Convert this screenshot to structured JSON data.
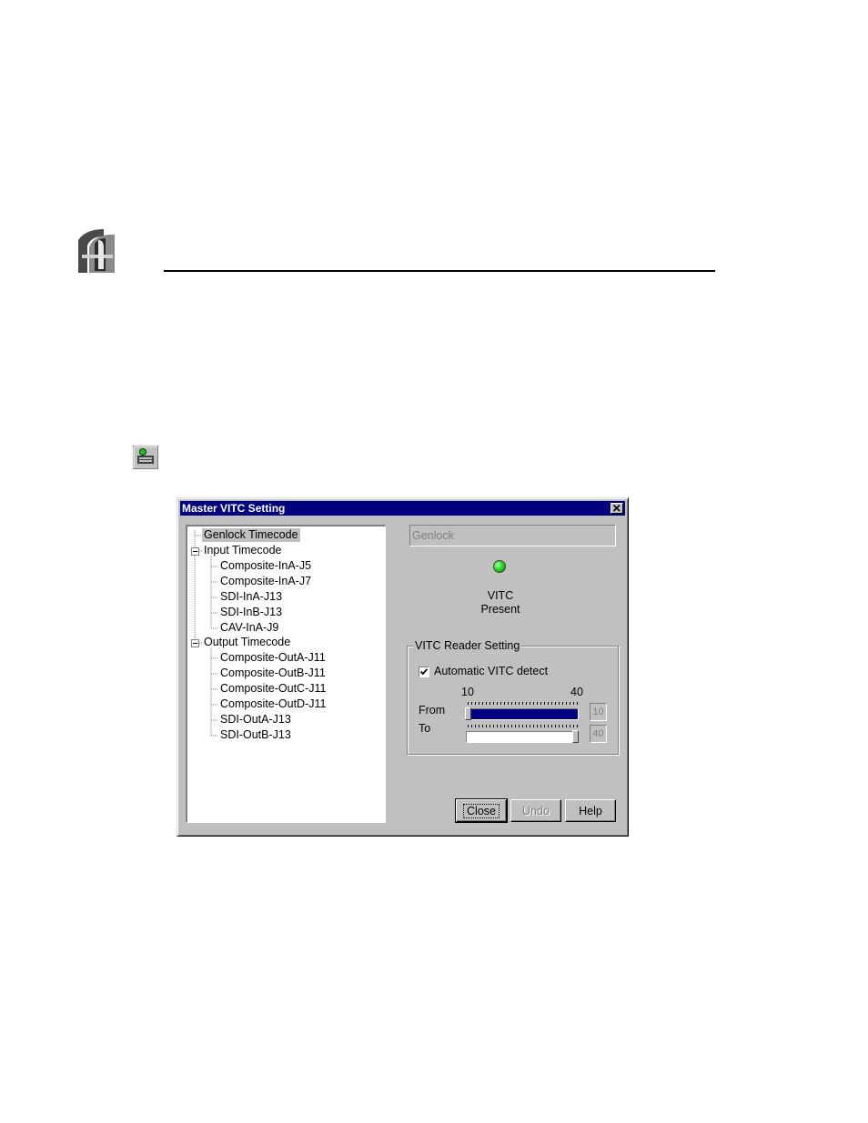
{
  "dialog": {
    "title": "Master VITC Setting"
  },
  "tree": {
    "genlock": "Genlock Timecode",
    "input": {
      "label": "Input Timecode",
      "children": [
        "Composite-InA-J5",
        "Composite-InA-J7",
        "SDI-InA-J13",
        "SDI-InB-J13",
        "CAV-InA-J9"
      ]
    },
    "output": {
      "label": "Output Timecode",
      "children": [
        "Composite-OutA-J11",
        "Composite-OutB-J11",
        "Composite-OutC-J11",
        "Composite-OutD-J11",
        "SDI-OutA-J13",
        "SDI-OutB-J13"
      ]
    }
  },
  "source_field": {
    "value": "Genlock"
  },
  "status": {
    "line1": "VITC",
    "line2": "Present",
    "led_color": "#20e020"
  },
  "reader": {
    "legend": "VITC Reader Setting",
    "auto_detect_label": "Automatic VITC detect",
    "auto_detect_checked": true,
    "min_label": "10",
    "max_label": "40",
    "from_label": "From",
    "to_label": "To",
    "from_value": "10",
    "to_value": "40",
    "from_fill_fraction": 1.0,
    "to_fill_fraction": 0.0
  },
  "buttons": {
    "close": "Close",
    "undo": "Undo",
    "help": "Help"
  },
  "colors": {
    "titlebar": "#000080",
    "dialog_face": "#c0c0c0",
    "slider_fill": "#000080"
  }
}
